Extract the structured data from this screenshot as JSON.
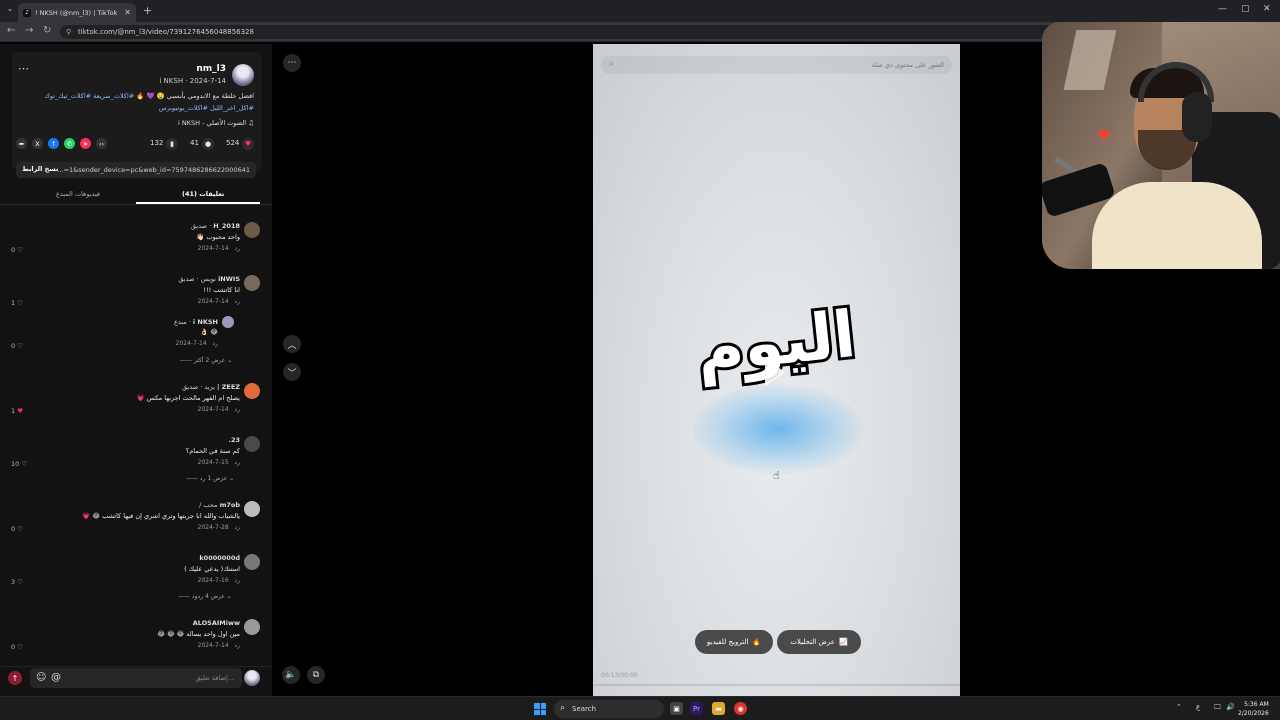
{
  "browser": {
    "tab_title": "! NKSH (@nm_l3) | TikTok",
    "url": "tiktok.com/@nm_l3/video/7391276456048856328"
  },
  "post": {
    "author_name": "nm_l3",
    "author_sub": "i NKSH · 2024-7-14",
    "desc_text": "افضل خلطة مع الاندومي بأنسبي 🤤 💜 🔥",
    "desc_tags1": "#اكلات_سريعة #اكلات_تيك_توك",
    "desc_tags2": "#اكل_اخر_الليل #اكلات_يوتيوبرس",
    "sound": "الصوت الأصلي - i NKSH",
    "likes": "524",
    "comments": "41",
    "saves": "132",
    "link_url": "...=1&sender_device=pc&web_id=7597486286622000641",
    "copy_link_label": "نسخ الرابط"
  },
  "tabs": {
    "comments_label": "تعليقات (41)",
    "creator_videos_label": "فيديوهات المبدع"
  },
  "comments": [
    {
      "name": "H_2018",
      "badge": "صديق",
      "text": "واحد محبوب 👋🏻",
      "date": "2024-7-14",
      "reply": "رد",
      "likes": "0",
      "liked": false,
      "avatar_color": "#6d5b4a"
    },
    {
      "name": "iNWIS",
      "badge": "نويس · صديق",
      "text": "انا كاتشب !!!",
      "date": "2024-7-14",
      "reply": "رد",
      "likes": "1",
      "liked": false,
      "avatar_color": "#7a6a5c"
    },
    {
      "name": "i NKSH",
      "badge": "مبدع",
      "text": "😂 👌🏻",
      "date": "2024-7-14",
      "reply": "رد",
      "likes": "0",
      "liked": false,
      "avatar_color": "#9a9ab8"
    },
    {
      "name": "ZEEZ |",
      "badge": "يزيد · صديق",
      "text": "يصلح ام الفهر مالحت اجربها مكس 💗",
      "date": "2024-7-14",
      "reply": "رد",
      "likes": "1",
      "liked": true,
      "avatar_color": "#e06a3a"
    },
    {
      "name": "23.",
      "badge": "",
      "text": "كم سنة في الحمام؟",
      "date": "2024-7-15",
      "reply": "رد",
      "likes": "10",
      "liked": false,
      "avatar_color": "#4a4a4a"
    },
    {
      "name": "m7ob",
      "badge": "محب /",
      "text": "يالشباب والله انا جربتها وتري اشري إن فيها كاتشب 😂 💗",
      "date": "2024-7-28",
      "reply": "رد",
      "likes": "0",
      "liked": false,
      "avatar_color": "#bbbbbb"
    },
    {
      "name": "k0000000d",
      "badge": "",
      "text": "استنك( يدعي عليك )",
      "date": "2024-7-16",
      "reply": "رد",
      "likes": "3",
      "liked": false,
      "avatar_color": "#777777"
    },
    {
      "name": "ALOSAIMiww",
      "badge": "",
      "text": "مين اول واحد يساله 😂 😂 😂",
      "date": "2024-7-14",
      "reply": "رد",
      "likes": "0",
      "liked": false,
      "avatar_color": "#999999"
    }
  ],
  "replies": [
    {
      "label": "عرض 2 أكثر"
    },
    {
      "label": "عرض 1 رد"
    },
    {
      "label": "عرض 4 ردود"
    }
  ],
  "composer": {
    "placeholder": "إضافة تعليق..."
  },
  "video": {
    "search_placeholder": "العثور على محتوى ذي صلة",
    "overlay_word": "اليوم",
    "promote_label": "الترويج للفيديو",
    "analytics_label": "عرض التحليلات",
    "time": "00:13/00:00"
  },
  "taskbar": {
    "search_label": "Search",
    "time": "5:36 AM",
    "date": "2/20/2026"
  },
  "colors": {
    "accent": "#fe2c55",
    "tag": "#8fb6ff"
  }
}
